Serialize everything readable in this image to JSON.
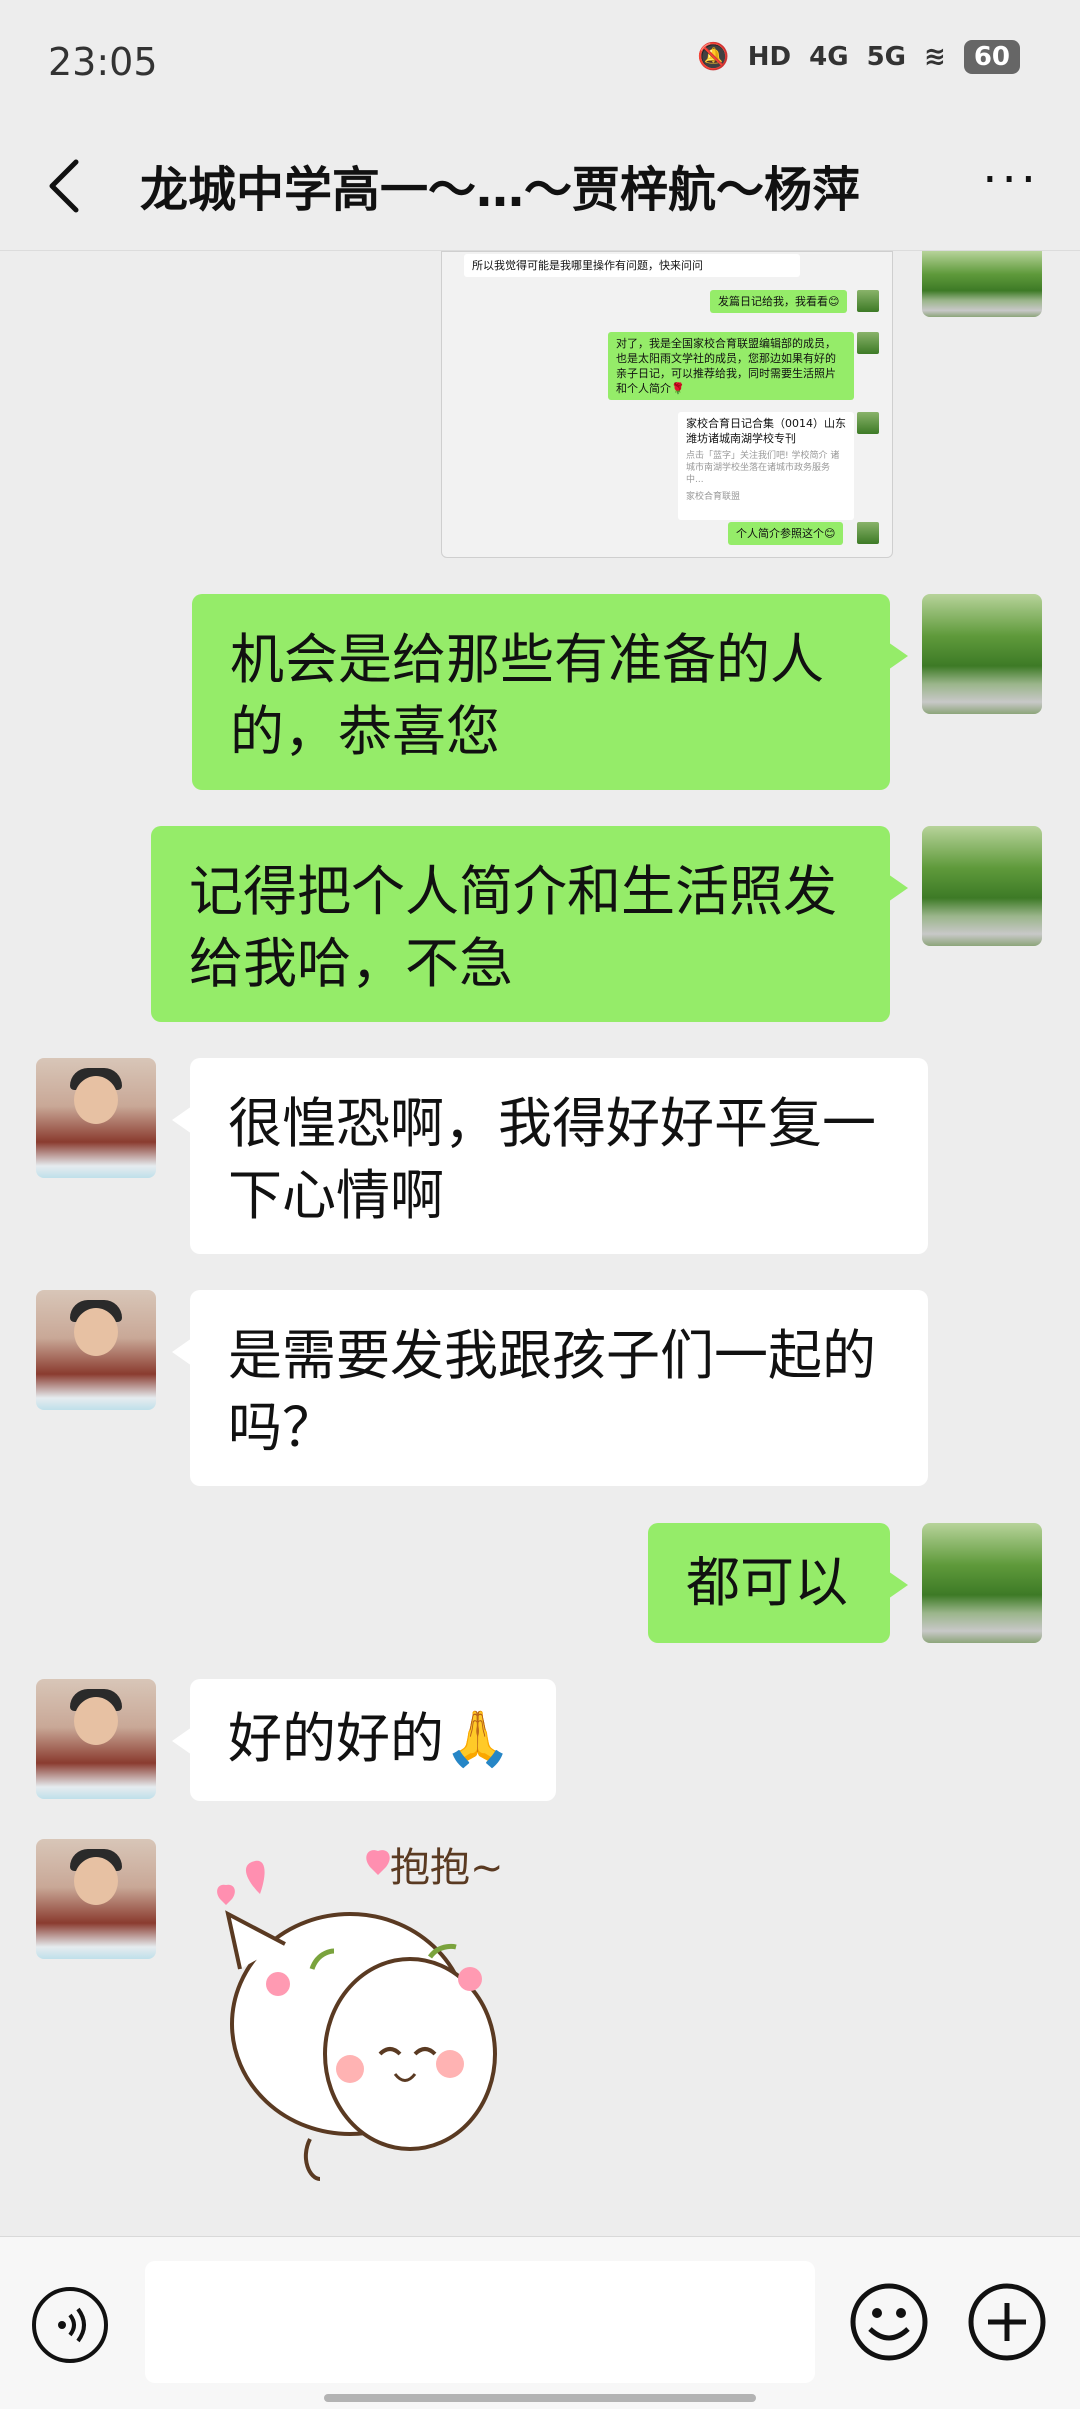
{
  "status": {
    "time": "23:05",
    "signal_1": "4G",
    "signal_2": "5G",
    "hd": "HD",
    "battery": "60"
  },
  "header": {
    "title": "龙城中学高一～…～贾梓航～杨萍"
  },
  "screenshot_preview": {
    "line1": "所以我觉得可能是我哪里操作有问题，快来问问",
    "line2": "发篇日记给我，我看看😊",
    "line3": "对了，我是全国家校合育联盟编辑部的成员，也是太阳雨文学社的成员，您那边如果有好的亲子日记，可以推荐给我，同时需要生活照片和个人简介🌹",
    "card_title": "家校合育日记合集（0014）山东潍坊诸城南湖学校专刊",
    "card_desc": "点击「蓝字」关注我们吧! 学校简介 诸城市南湖学校坐落在诸城市政务服务中...",
    "card_source": "家校合育联盟",
    "line4": "个人简介参照这个😊"
  },
  "messages": [
    {
      "from": "me",
      "text": "机会是给那些有准备的人的，恭喜您"
    },
    {
      "from": "me",
      "text": "记得把个人简介和生活照发给我哈，不急"
    },
    {
      "from": "other",
      "text": "很惶恐啊，我得好好平复一下心情啊"
    },
    {
      "from": "other",
      "text": "是需要发我跟孩子们一起的吗？"
    },
    {
      "from": "me",
      "text": "都可以"
    },
    {
      "from": "other",
      "text": "好的好的🙏"
    }
  ],
  "sticker": {
    "text": "抱抱~"
  },
  "input": {
    "value": ""
  },
  "icons": {
    "back": "back-arrow-icon",
    "more": "more-icon",
    "voice": "voice-icon",
    "emoji": "emoji-icon",
    "plus": "plus-icon"
  }
}
